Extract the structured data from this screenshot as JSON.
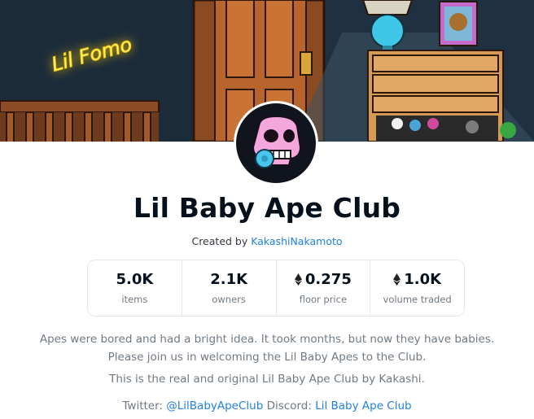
{
  "banner": {
    "neon_sign": "Lil Fomo"
  },
  "collection": {
    "name": "Lil Baby Ape Club",
    "created_by_prefix": "Created by",
    "creator": "KakashiNakamoto"
  },
  "stats": [
    {
      "value": "5.0K",
      "label": "items",
      "eth": false
    },
    {
      "value": "2.1K",
      "label": "owners",
      "eth": false
    },
    {
      "value": "0.275",
      "label": "floor price",
      "eth": true
    },
    {
      "value": "1.0K",
      "label": "volume traded",
      "eth": true
    }
  ],
  "description": {
    "paragraph1": "Apes were bored and had a bright idea. It took months, but now they have babies. Please join us in welcoming the Lil Baby Apes to the Club.",
    "paragraph2": "This is the real and original Lil Baby Ape Club by Kakashi.",
    "twitter_label": "Twitter:",
    "twitter_handle": "@LilBabyApeClub",
    "discord_label": "Discord:",
    "discord_name": "Lil Baby Ape Club"
  },
  "colors": {
    "link": "#2081e2",
    "text": "#04111d",
    "muted": "#707a83"
  }
}
